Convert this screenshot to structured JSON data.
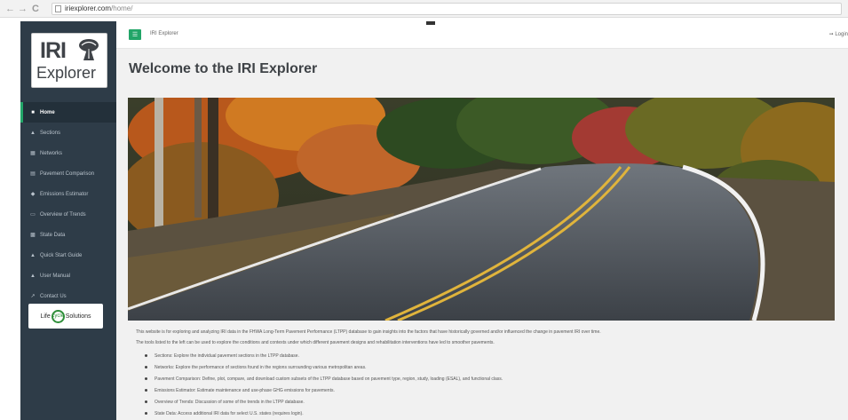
{
  "browser": {
    "back_icon": "arrow-left-icon",
    "forward_icon": "arrow-right-icon",
    "reload_icon": "reload-icon",
    "url_host": "iriexplorer.com",
    "url_path": "/home/"
  },
  "sidebar": {
    "logo": {
      "top": "IRI",
      "bottom": "Explorer"
    },
    "items": [
      {
        "label": "Home",
        "icon": "home-icon",
        "active": true
      },
      {
        "label": "Sections",
        "icon": "road-icon",
        "active": false
      },
      {
        "label": "Networks",
        "icon": "network-icon",
        "active": false
      },
      {
        "label": "Pavement Comparison",
        "icon": "table-icon",
        "active": false
      },
      {
        "label": "Emissions Estimator",
        "icon": "car-icon",
        "active": false
      },
      {
        "label": "Overview of Trends",
        "icon": "chart-icon",
        "active": false
      },
      {
        "label": "State Data",
        "icon": "calendar-icon",
        "active": false
      },
      {
        "label": "Quick Start Guide",
        "icon": "warning-icon",
        "active": false
      },
      {
        "label": "User Manual",
        "icon": "warning-icon",
        "active": false
      },
      {
        "label": "Contact Us",
        "icon": "external-link-icon",
        "active": false
      }
    ],
    "partner": {
      "left": "Life",
      "circle": "cycle",
      "right": "Solutions"
    }
  },
  "topbar": {
    "breadcrumb": "IRI Explorer",
    "login": "Login"
  },
  "main": {
    "title": "Welcome to the IRI Explorer",
    "intro": [
      "This website is for exploring and analyzing IRI data in the FHWA Long-Term Pavement Performance (LTPP) database to gain insights into the factors that have historically governed and/or influenced the change in pavement IRI over time.",
      "The tools listed to the left can be used to explore the conditions and contexts under which different pavement designs and rehabilitation interventions have led to smoother pavements."
    ],
    "bullets": [
      "Sections: Explore the individual pavement sections in the LTPP database.",
      "Networks: Explore the performance of sections found in the regions surrounding various metropolitan areas.",
      "Pavement Comparison: Define, plot, compare, and download custom subsets of the LTPP database based on pavement type, region, study, loading (ESAL), and functional class.",
      "Emissions Estimator: Estimate maintenance and use-phase GHG emissions for pavements.",
      "Overview of Trends: Discussion of some of the trends in the LTPP database.",
      "State Data: Access additional IRI data for select U.S. states (requires login)."
    ]
  },
  "colors": {
    "sidebar": "#2e3c48",
    "accent": "#22a568",
    "content_bg": "#f1f1f1"
  }
}
